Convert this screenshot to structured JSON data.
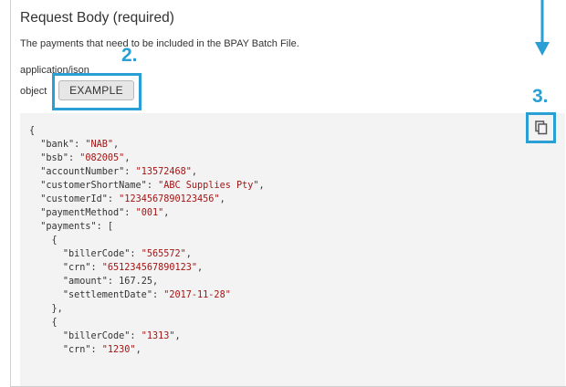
{
  "request_body": {
    "title": "Request Body (required)",
    "description": "The payments that need to be included in the BPAY Batch File.",
    "content_type": "application/json",
    "object_label": "object",
    "example_button_label": "EXAMPLE"
  },
  "annotations": {
    "step2": "2.",
    "step3": "3.",
    "accent_color": "#2a9fd6"
  },
  "icons": {
    "copy": "copy-icon",
    "arrow": "arrow-down-icon"
  },
  "example_json": {
    "lines": [
      [
        {
          "t": "p",
          "v": "{"
        }
      ],
      [
        {
          "t": "p",
          "v": "  "
        },
        {
          "t": "k",
          "v": "\"bank\""
        },
        {
          "t": "p",
          "v": ": "
        },
        {
          "t": "s",
          "v": "\"NAB\""
        },
        {
          "t": "p",
          "v": ","
        }
      ],
      [
        {
          "t": "p",
          "v": "  "
        },
        {
          "t": "k",
          "v": "\"bsb\""
        },
        {
          "t": "p",
          "v": ": "
        },
        {
          "t": "s",
          "v": "\"082005\""
        },
        {
          "t": "p",
          "v": ","
        }
      ],
      [
        {
          "t": "p",
          "v": "  "
        },
        {
          "t": "k",
          "v": "\"accountNumber\""
        },
        {
          "t": "p",
          "v": ": "
        },
        {
          "t": "s",
          "v": "\"13572468\""
        },
        {
          "t": "p",
          "v": ","
        }
      ],
      [
        {
          "t": "p",
          "v": "  "
        },
        {
          "t": "k",
          "v": "\"customerShortName\""
        },
        {
          "t": "p",
          "v": ": "
        },
        {
          "t": "s",
          "v": "\"ABC Supplies Pty\""
        },
        {
          "t": "p",
          "v": ","
        }
      ],
      [
        {
          "t": "p",
          "v": "  "
        },
        {
          "t": "k",
          "v": "\"customerId\""
        },
        {
          "t": "p",
          "v": ": "
        },
        {
          "t": "s",
          "v": "\"1234567890123456\""
        },
        {
          "t": "p",
          "v": ","
        }
      ],
      [
        {
          "t": "p",
          "v": "  "
        },
        {
          "t": "k",
          "v": "\"paymentMethod\""
        },
        {
          "t": "p",
          "v": ": "
        },
        {
          "t": "s",
          "v": "\"001\""
        },
        {
          "t": "p",
          "v": ","
        }
      ],
      [
        {
          "t": "p",
          "v": "  "
        },
        {
          "t": "k",
          "v": "\"payments\""
        },
        {
          "t": "p",
          "v": ": ["
        }
      ],
      [
        {
          "t": "p",
          "v": "    {"
        }
      ],
      [
        {
          "t": "p",
          "v": "      "
        },
        {
          "t": "k",
          "v": "\"billerCode\""
        },
        {
          "t": "p",
          "v": ": "
        },
        {
          "t": "s",
          "v": "\"565572\""
        },
        {
          "t": "p",
          "v": ","
        }
      ],
      [
        {
          "t": "p",
          "v": "      "
        },
        {
          "t": "k",
          "v": "\"crn\""
        },
        {
          "t": "p",
          "v": ": "
        },
        {
          "t": "s",
          "v": "\"651234567890123\""
        },
        {
          "t": "p",
          "v": ","
        }
      ],
      [
        {
          "t": "p",
          "v": "      "
        },
        {
          "t": "k",
          "v": "\"amount\""
        },
        {
          "t": "p",
          "v": ": "
        },
        {
          "t": "n",
          "v": "167.25"
        },
        {
          "t": "p",
          "v": ","
        }
      ],
      [
        {
          "t": "p",
          "v": "      "
        },
        {
          "t": "k",
          "v": "\"settlementDate\""
        },
        {
          "t": "p",
          "v": ": "
        },
        {
          "t": "s",
          "v": "\"2017-11-28\""
        }
      ],
      [
        {
          "t": "p",
          "v": "    },"
        }
      ],
      [
        {
          "t": "p",
          "v": "    {"
        }
      ],
      [
        {
          "t": "p",
          "v": "      "
        },
        {
          "t": "k",
          "v": "\"billerCode\""
        },
        {
          "t": "p",
          "v": ": "
        },
        {
          "t": "s",
          "v": "\"1313\""
        },
        {
          "t": "p",
          "v": ","
        }
      ],
      [
        {
          "t": "p",
          "v": "      "
        },
        {
          "t": "k",
          "v": "\"crn\""
        },
        {
          "t": "p",
          "v": ": "
        },
        {
          "t": "s",
          "v": "\"1230\""
        },
        {
          "t": "p",
          "v": ","
        }
      ]
    ]
  }
}
